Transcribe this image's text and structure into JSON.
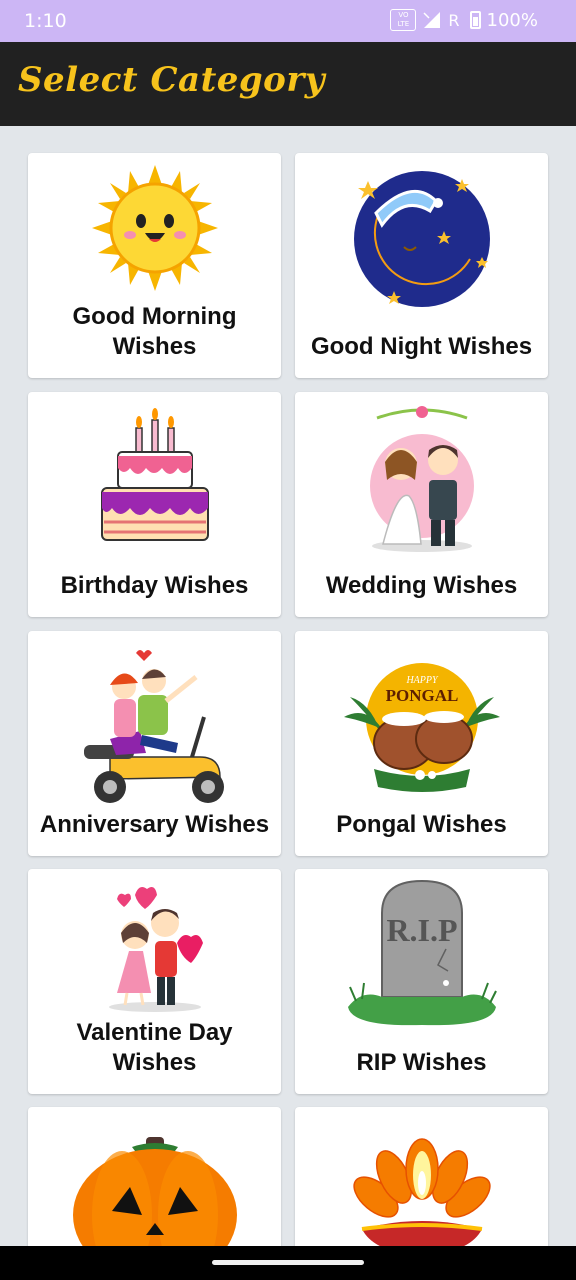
{
  "status_bar": {
    "time": "1:10",
    "volte_top": "VO",
    "volte_bottom": "LTE",
    "roaming": "R",
    "battery": "100%"
  },
  "app_bar": {
    "title": "Select Category"
  },
  "categories": [
    {
      "label": "Good Morning Wishes",
      "icon": "sun-icon"
    },
    {
      "label": "Good Night Wishes",
      "icon": "moon-icon"
    },
    {
      "label": "Birthday Wishes",
      "icon": "cake-icon"
    },
    {
      "label": "Wedding Wishes",
      "icon": "wedding-couple-icon"
    },
    {
      "label": "Anniversary Wishes",
      "icon": "scooter-couple-icon"
    },
    {
      "label": "Pongal Wishes",
      "icon": "pongal-pot-icon",
      "icon_text_top": "HAPPY",
      "icon_text": "PONGAL"
    },
    {
      "label": "Valentine Day Wishes",
      "icon": "valentine-couple-icon"
    },
    {
      "label": "RIP Wishes",
      "icon": "tombstone-icon",
      "icon_text": "R.I.P"
    },
    {
      "label": "",
      "icon": "pumpkin-icon"
    },
    {
      "label": "",
      "icon": "diya-lamp-icon"
    }
  ],
  "colors": {
    "status_bar": "#ccb6f5",
    "app_bar": "#212121",
    "title": "#f7c31c",
    "background": "#e2e6ea",
    "card": "#ffffff"
  }
}
